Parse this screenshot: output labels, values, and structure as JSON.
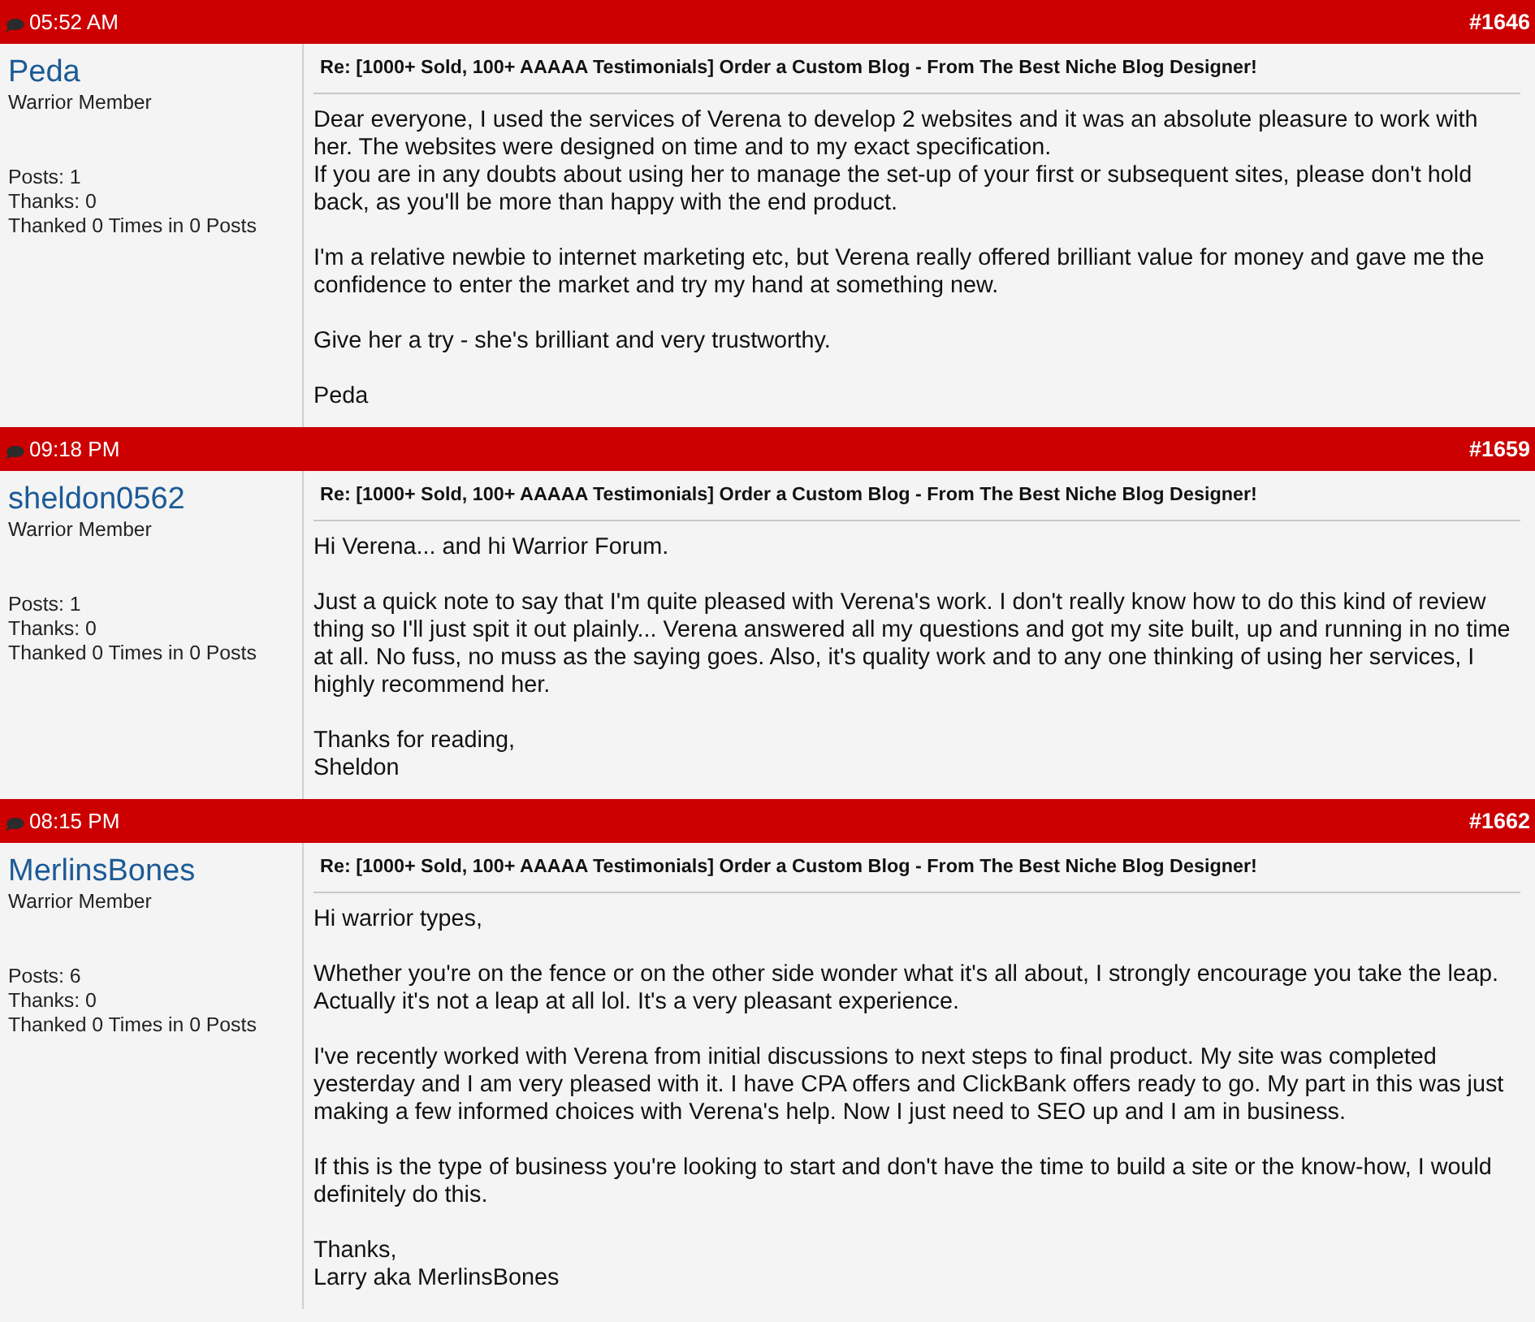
{
  "posts": [
    {
      "time": "05:52 AM",
      "number": "#1646",
      "author": {
        "username": "Peda",
        "rank": "Warrior Member",
        "stats": [
          "Posts: 1",
          "Thanks: 0",
          "Thanked 0 Times in 0 Posts"
        ]
      },
      "title": "Re: [1000+ Sold, 100+ AAAAA Testimonials] Order a Custom Blog - From The Best Niche Blog Designer!",
      "paragraphs": [
        "Dear everyone, I used the services of Verena to develop 2 websites and it was an absolute pleasure to work with her. The websites were designed on time and to my exact specification.\nIf you are in any doubts about using her to manage the set-up of your first or subsequent sites, please don't hold back, as you'll be more than happy with the end product.",
        "I'm a relative newbie to internet marketing etc, but Verena really offered brilliant value for money and gave me the confidence to enter the market and try my hand at something new.",
        "Give her a try - she's brilliant and very trustworthy.",
        "Peda"
      ]
    },
    {
      "time": "09:18 PM",
      "number": "#1659",
      "author": {
        "username": "sheldon0562",
        "rank": "Warrior Member",
        "stats": [
          "Posts: 1",
          "Thanks: 0",
          "Thanked 0 Times in 0 Posts"
        ]
      },
      "title": "Re: [1000+ Sold, 100+ AAAAA Testimonials] Order a Custom Blog - From The Best Niche Blog Designer!",
      "paragraphs": [
        "Hi Verena... and hi Warrior Forum.",
        "Just a quick note to say that I'm quite pleased with Verena's work. I don't really know how to do this kind of review thing so I'll just spit it out plainly... Verena answered all my questions and got my site built, up and running in no time at all. No fuss, no muss as the saying goes. Also, it's quality work and to any one thinking of using her services, I highly recommend her.",
        "Thanks for reading,\nSheldon"
      ]
    },
    {
      "time": "08:15 PM",
      "number": "#1662",
      "author": {
        "username": "MerlinsBones",
        "rank": "Warrior Member",
        "stats": [
          "Posts: 6",
          "Thanks: 0",
          "Thanked 0 Times in 0 Posts"
        ]
      },
      "title": "Re: [1000+ Sold, 100+ AAAAA Testimonials] Order a Custom Blog - From The Best Niche Blog Designer!",
      "paragraphs": [
        "Hi warrior types,",
        "Whether you're on the fence or on the other side wonder what it's all about, I strongly encourage you take the leap. Actually it's not a leap at all lol. It's a very pleasant experience.",
        "I've recently worked with Verena from initial discussions to next steps to final product. My site was completed yesterday and I am very pleased with it. I have CPA offers and ClickBank offers ready to go. My part in this was just making a few informed choices with Verena's help. Now I just need to SEO up and I am in business.",
        "If this is the type of business you're looking to start and don't have the time to build a site or the know-how, I would definitely do this.",
        "Thanks,\nLarry aka MerlinsBones"
      ]
    }
  ]
}
